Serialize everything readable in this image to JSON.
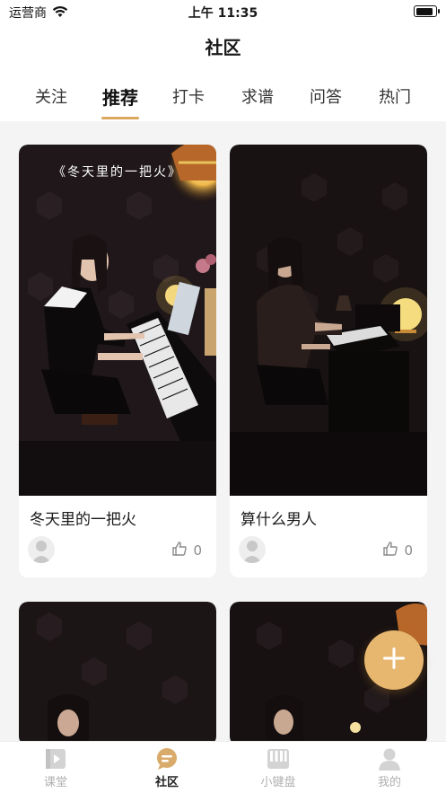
{
  "status_bar": {
    "carrier": "运营商",
    "time": "上午 11:35",
    "battery_level": 0.9
  },
  "header": {
    "title": "社区"
  },
  "tabs": [
    {
      "label": "关注",
      "active": false
    },
    {
      "label": "推荐",
      "active": true
    },
    {
      "label": "打卡",
      "active": false
    },
    {
      "label": "求谱",
      "active": false
    },
    {
      "label": "问答",
      "active": false
    },
    {
      "label": "热门",
      "active": false
    }
  ],
  "feed": [
    {
      "overlay_text": "《冬天里的一把火》",
      "title": "冬天里的一把火",
      "likes": "0"
    },
    {
      "overlay_text": "",
      "title": "算什么男人",
      "likes": "0"
    },
    {
      "overlay_text": "",
      "title": "",
      "likes": ""
    },
    {
      "overlay_text": "",
      "title": "",
      "likes": ""
    }
  ],
  "fab": {
    "icon": "plus-icon"
  },
  "tabbar": [
    {
      "label": "课堂",
      "icon": "classroom-icon",
      "active": false
    },
    {
      "label": "社区",
      "icon": "community-icon",
      "active": true
    },
    {
      "label": "小键盘",
      "icon": "piano-keyboard-icon",
      "active": false
    },
    {
      "label": "我的",
      "icon": "profile-icon",
      "active": false
    }
  ],
  "colors": {
    "accent": "#e7b770",
    "underline": "#d9a85c",
    "background": "#f4f4f4"
  }
}
